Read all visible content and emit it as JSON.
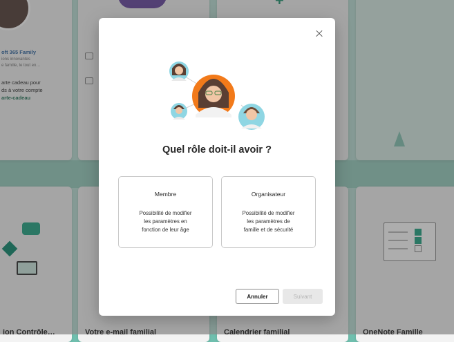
{
  "background": {
    "cards": [
      {
        "title": "ion Contrôle…"
      },
      {
        "title": "Votre e-mail familial"
      },
      {
        "title": "Calendrier familial"
      },
      {
        "title": "OneNote Famille"
      }
    ],
    "promo": {
      "brand": "oft 365 Family",
      "subtitle_line1": "ions innovantes",
      "subtitle_line2": "e famille, le tout en…",
      "body_line1": "arte cadeau pour",
      "body_line2": "ds à votre compte",
      "link": "arte-cadeau"
    }
  },
  "dialog": {
    "title": "Quel rôle doit-il avoir ?",
    "options": [
      {
        "title": "Membre",
        "desc_line1": "Possibilité de modifier",
        "desc_line2": "les paramètres en",
        "desc_line3": "fonction de leur âge"
      },
      {
        "title": "Organisateur",
        "desc_line1": "Possibilité de modifier",
        "desc_line2": "les paramètres de",
        "desc_line3": "famille et de sécurité"
      }
    ],
    "cancel_label": "Annuler",
    "next_label": "Suivant"
  },
  "colors": {
    "accent": "#2ea889",
    "avatar_center": "#f27a1a",
    "avatar_side": "#8fd6e3",
    "overlay_bg": "#bfe1d8"
  }
}
